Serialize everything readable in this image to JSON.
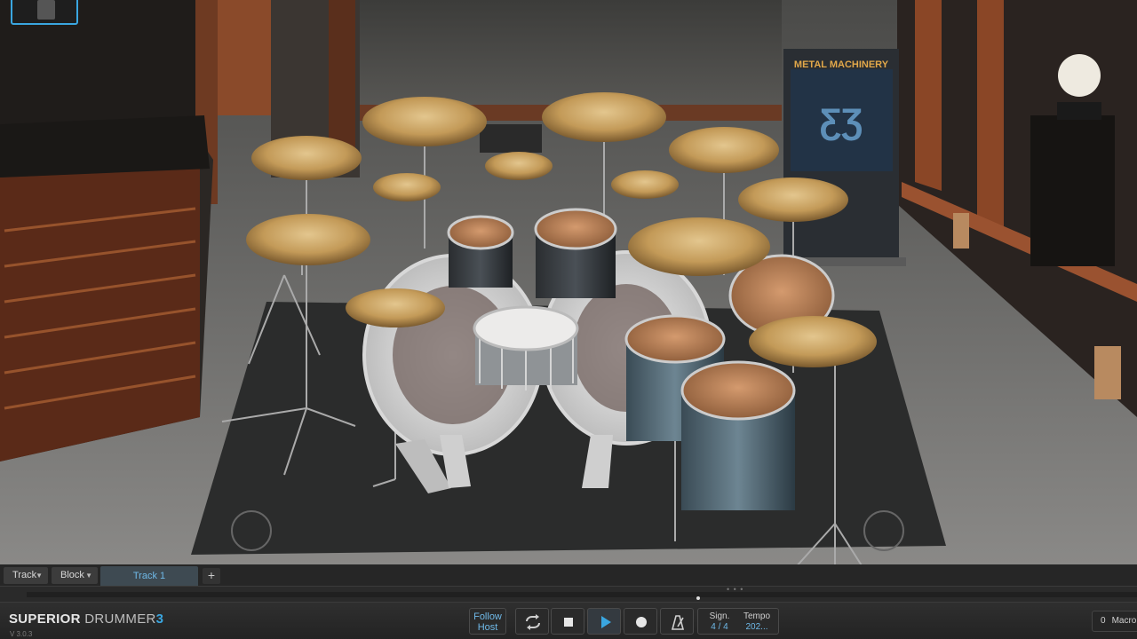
{
  "window": {
    "title": "Superior Drummer 3"
  },
  "banner": {
    "title": "METAL MACHINERY",
    "subtitle": ""
  },
  "trackbar": {
    "track_menu": "Track",
    "block_menu": "Block",
    "active_tab": "Track 1",
    "add_label": "+"
  },
  "footer": {
    "brand_word1": "SUPERIOR",
    "brand_word2": "DRUMMER",
    "brand_number": "3",
    "version": "V 3.0.3",
    "follow_host_line1": "Follow",
    "follow_host_line2": "Host",
    "signature_label": "Sign.",
    "signature_value": "4 / 4",
    "tempo_label": "Tempo",
    "tempo_value": "202...",
    "macro_value": "0",
    "macro_label": "Macro"
  },
  "transport_icons": [
    "loop-icon",
    "stop-icon",
    "play-icon",
    "record-icon",
    "metronome-icon"
  ],
  "colors": {
    "accent": "#3aa6e0",
    "bronze": "#c9a25e",
    "tab_text": "#6fb9e8"
  }
}
